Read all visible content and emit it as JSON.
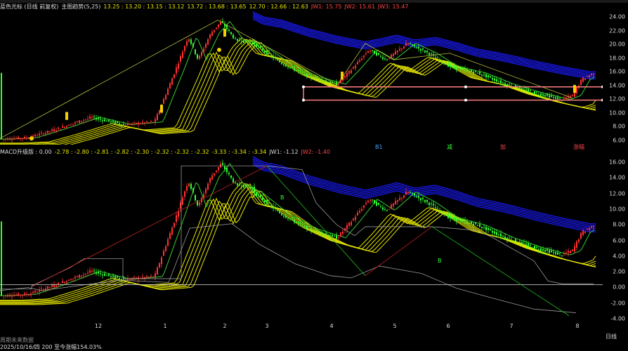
{
  "top_panel": {
    "legend": [
      {
        "text": "蓝色光标 (日线 前复权)",
        "color": "#dddddd"
      },
      {
        "text": "主图趋势(5,25)",
        "color": "#dddddd"
      },
      {
        "text": "13.25 : 13.20 : 13.15 : 13.12",
        "color": "#e6e600"
      },
      {
        "text": "13.72 : 13.68 : 13.65",
        "color": "#e6e600"
      },
      {
        "text": "12.70 : 12.66 : 12.63",
        "color": "#e6e600"
      },
      {
        "text": "JW1: 15.75",
        "color": "#ff4444"
      },
      {
        "text": "JW2: 15.61",
        "color": "#ff4444"
      },
      {
        "text": "JW3: 15.47",
        "color": "#ff4444"
      }
    ],
    "y_ticks": [
      "24.00",
      "22.00",
      "20.00",
      "18.00",
      "16.00",
      "14.00",
      "12.00",
      "10.00",
      "8.00",
      "6.00"
    ]
  },
  "bottom_panel": {
    "legend": [
      {
        "text": "MACD升级版 : 0.00",
        "color": "#dddddd"
      },
      {
        "text": "-2.78 : -2.80 : -2.81 : -2.82 : -2.30 : -2.32 : -2.32 : -2.32",
        "color": "#e6e600"
      },
      {
        "text": "-3.33 : -3.34 : -3.34",
        "color": "#e6e600"
      },
      {
        "text": "JW1: -1.12",
        "color": "#dddddd"
      },
      {
        "text": "JW2: -1.40",
        "color": "#ff4444"
      }
    ],
    "badges": [
      {
        "text": "B1",
        "color": "#4aa3ff"
      },
      {
        "text": "减",
        "color": "#33ff33"
      },
      {
        "text": "加",
        "color": "#ff4444"
      },
      {
        "text": "涨幅",
        "color": "#ff4444"
      },
      {
        "text": "B",
        "color": "#33ff33"
      },
      {
        "text": "B",
        "color": "#33ff33"
      }
    ],
    "y_ticks": [
      "16.00",
      "14.00",
      "12.00",
      "10.00",
      "8.00",
      "6.00",
      "4.00",
      "2.00",
      "0.00",
      "-2.00",
      "-4.00"
    ]
  },
  "x_ticks": [
    "12",
    "1",
    "2",
    "3",
    "4",
    "5",
    "6",
    "7",
    "8"
  ],
  "status_line1": "周期未来数据",
  "status_line2": "2025/10/16/四 200 至今涨幅154.03%",
  "period_label": "日线",
  "colors": {
    "up": "#ff3333",
    "down": "#33ff33",
    "band_yellow": "#e6e600",
    "band_blue": "#1a1aff",
    "support": "#ff8080"
  }
}
